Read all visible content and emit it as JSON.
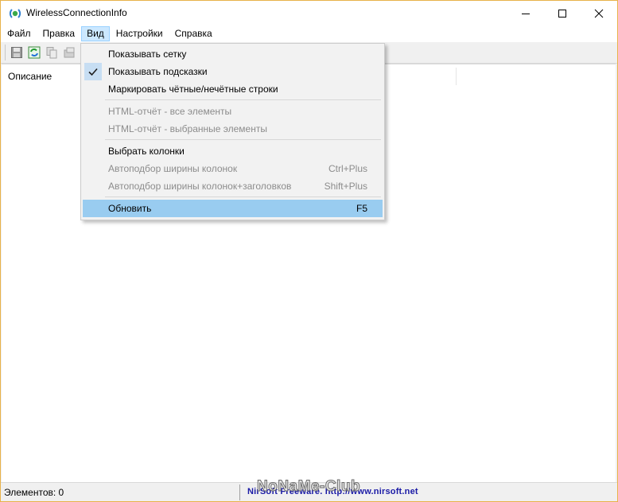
{
  "window": {
    "title": "WirelessConnectionInfo",
    "border_color": "#e8b24a"
  },
  "menubar": {
    "items": [
      "Файл",
      "Правка",
      "Вид",
      "Настройки",
      "Справка"
    ]
  },
  "listview": {
    "column_header": "Описание"
  },
  "dropdown": {
    "items": [
      {
        "label": "Показывать сетку",
        "shortcut": "",
        "enabled": true,
        "checked": false
      },
      {
        "label": "Показывать подсказки",
        "shortcut": "",
        "enabled": true,
        "checked": true
      },
      {
        "label": "Маркировать чётные/нечётные строки",
        "shortcut": "",
        "enabled": true,
        "checked": false
      },
      {
        "label": "HTML-отчёт - все элементы",
        "shortcut": "",
        "enabled": false,
        "checked": false
      },
      {
        "label": "HTML-отчёт - выбранные элементы",
        "shortcut": "",
        "enabled": false,
        "checked": false
      },
      {
        "label": "Выбрать колонки",
        "shortcut": "",
        "enabled": true,
        "checked": false
      },
      {
        "label": "Автоподбор ширины колонок",
        "shortcut": "Ctrl+Plus",
        "enabled": false,
        "checked": false
      },
      {
        "label": "Автоподбор ширины колонок+заголовков",
        "shortcut": "Shift+Plus",
        "enabled": false,
        "checked": false
      },
      {
        "label": "Обновить",
        "shortcut": "F5",
        "enabled": true,
        "checked": false,
        "highlighted": true
      }
    ]
  },
  "statusbar": {
    "count": "Элементов: 0",
    "link": "NirSoft Freeware.  http://www.nirsoft.net"
  },
  "watermark": "NoNaMe-Club"
}
